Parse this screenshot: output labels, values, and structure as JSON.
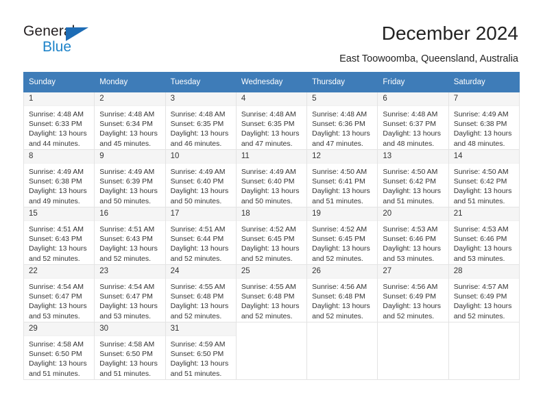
{
  "brand": {
    "name_top": "General",
    "name_bottom": "Blue",
    "logo_icon": "triangle-flag-icon",
    "accent_color": "#1d6cb5",
    "blue_text_color": "#1d83c9"
  },
  "header": {
    "title": "December 2024",
    "subtitle": "East Toowoomba, Queensland, Australia"
  },
  "calendar": {
    "header_bg": "#3e7cb8",
    "daynum_bg": "#f5f5f5",
    "weekdays": [
      "Sunday",
      "Monday",
      "Tuesday",
      "Wednesday",
      "Thursday",
      "Friday",
      "Saturday"
    ],
    "labels": {
      "sunrise": "Sunrise:",
      "sunset": "Sunset:",
      "daylight": "Daylight:"
    },
    "weeks": [
      [
        {
          "day": "1",
          "sunrise": "Sunrise: 4:48 AM",
          "sunset": "Sunset: 6:33 PM",
          "daylight1": "Daylight: 13 hours",
          "daylight2": "and 44 minutes."
        },
        {
          "day": "2",
          "sunrise": "Sunrise: 4:48 AM",
          "sunset": "Sunset: 6:34 PM",
          "daylight1": "Daylight: 13 hours",
          "daylight2": "and 45 minutes."
        },
        {
          "day": "3",
          "sunrise": "Sunrise: 4:48 AM",
          "sunset": "Sunset: 6:35 PM",
          "daylight1": "Daylight: 13 hours",
          "daylight2": "and 46 minutes."
        },
        {
          "day": "4",
          "sunrise": "Sunrise: 4:48 AM",
          "sunset": "Sunset: 6:35 PM",
          "daylight1": "Daylight: 13 hours",
          "daylight2": "and 47 minutes."
        },
        {
          "day": "5",
          "sunrise": "Sunrise: 4:48 AM",
          "sunset": "Sunset: 6:36 PM",
          "daylight1": "Daylight: 13 hours",
          "daylight2": "and 47 minutes."
        },
        {
          "day": "6",
          "sunrise": "Sunrise: 4:48 AM",
          "sunset": "Sunset: 6:37 PM",
          "daylight1": "Daylight: 13 hours",
          "daylight2": "and 48 minutes."
        },
        {
          "day": "7",
          "sunrise": "Sunrise: 4:49 AM",
          "sunset": "Sunset: 6:38 PM",
          "daylight1": "Daylight: 13 hours",
          "daylight2": "and 48 minutes."
        }
      ],
      [
        {
          "day": "8",
          "sunrise": "Sunrise: 4:49 AM",
          "sunset": "Sunset: 6:38 PM",
          "daylight1": "Daylight: 13 hours",
          "daylight2": "and 49 minutes."
        },
        {
          "day": "9",
          "sunrise": "Sunrise: 4:49 AM",
          "sunset": "Sunset: 6:39 PM",
          "daylight1": "Daylight: 13 hours",
          "daylight2": "and 50 minutes."
        },
        {
          "day": "10",
          "sunrise": "Sunrise: 4:49 AM",
          "sunset": "Sunset: 6:40 PM",
          "daylight1": "Daylight: 13 hours",
          "daylight2": "and 50 minutes."
        },
        {
          "day": "11",
          "sunrise": "Sunrise: 4:49 AM",
          "sunset": "Sunset: 6:40 PM",
          "daylight1": "Daylight: 13 hours",
          "daylight2": "and 50 minutes."
        },
        {
          "day": "12",
          "sunrise": "Sunrise: 4:50 AM",
          "sunset": "Sunset: 6:41 PM",
          "daylight1": "Daylight: 13 hours",
          "daylight2": "and 51 minutes."
        },
        {
          "day": "13",
          "sunrise": "Sunrise: 4:50 AM",
          "sunset": "Sunset: 6:42 PM",
          "daylight1": "Daylight: 13 hours",
          "daylight2": "and 51 minutes."
        },
        {
          "day": "14",
          "sunrise": "Sunrise: 4:50 AM",
          "sunset": "Sunset: 6:42 PM",
          "daylight1": "Daylight: 13 hours",
          "daylight2": "and 51 minutes."
        }
      ],
      [
        {
          "day": "15",
          "sunrise": "Sunrise: 4:51 AM",
          "sunset": "Sunset: 6:43 PM",
          "daylight1": "Daylight: 13 hours",
          "daylight2": "and 52 minutes."
        },
        {
          "day": "16",
          "sunrise": "Sunrise: 4:51 AM",
          "sunset": "Sunset: 6:43 PM",
          "daylight1": "Daylight: 13 hours",
          "daylight2": "and 52 minutes."
        },
        {
          "day": "17",
          "sunrise": "Sunrise: 4:51 AM",
          "sunset": "Sunset: 6:44 PM",
          "daylight1": "Daylight: 13 hours",
          "daylight2": "and 52 minutes."
        },
        {
          "day": "18",
          "sunrise": "Sunrise: 4:52 AM",
          "sunset": "Sunset: 6:45 PM",
          "daylight1": "Daylight: 13 hours",
          "daylight2": "and 52 minutes."
        },
        {
          "day": "19",
          "sunrise": "Sunrise: 4:52 AM",
          "sunset": "Sunset: 6:45 PM",
          "daylight1": "Daylight: 13 hours",
          "daylight2": "and 52 minutes."
        },
        {
          "day": "20",
          "sunrise": "Sunrise: 4:53 AM",
          "sunset": "Sunset: 6:46 PM",
          "daylight1": "Daylight: 13 hours",
          "daylight2": "and 53 minutes."
        },
        {
          "day": "21",
          "sunrise": "Sunrise: 4:53 AM",
          "sunset": "Sunset: 6:46 PM",
          "daylight1": "Daylight: 13 hours",
          "daylight2": "and 53 minutes."
        }
      ],
      [
        {
          "day": "22",
          "sunrise": "Sunrise: 4:54 AM",
          "sunset": "Sunset: 6:47 PM",
          "daylight1": "Daylight: 13 hours",
          "daylight2": "and 53 minutes."
        },
        {
          "day": "23",
          "sunrise": "Sunrise: 4:54 AM",
          "sunset": "Sunset: 6:47 PM",
          "daylight1": "Daylight: 13 hours",
          "daylight2": "and 53 minutes."
        },
        {
          "day": "24",
          "sunrise": "Sunrise: 4:55 AM",
          "sunset": "Sunset: 6:48 PM",
          "daylight1": "Daylight: 13 hours",
          "daylight2": "and 52 minutes."
        },
        {
          "day": "25",
          "sunrise": "Sunrise: 4:55 AM",
          "sunset": "Sunset: 6:48 PM",
          "daylight1": "Daylight: 13 hours",
          "daylight2": "and 52 minutes."
        },
        {
          "day": "26",
          "sunrise": "Sunrise: 4:56 AM",
          "sunset": "Sunset: 6:48 PM",
          "daylight1": "Daylight: 13 hours",
          "daylight2": "and 52 minutes."
        },
        {
          "day": "27",
          "sunrise": "Sunrise: 4:56 AM",
          "sunset": "Sunset: 6:49 PM",
          "daylight1": "Daylight: 13 hours",
          "daylight2": "and 52 minutes."
        },
        {
          "day": "28",
          "sunrise": "Sunrise: 4:57 AM",
          "sunset": "Sunset: 6:49 PM",
          "daylight1": "Daylight: 13 hours",
          "daylight2": "and 52 minutes."
        }
      ],
      [
        {
          "day": "29",
          "sunrise": "Sunrise: 4:58 AM",
          "sunset": "Sunset: 6:50 PM",
          "daylight1": "Daylight: 13 hours",
          "daylight2": "and 51 minutes."
        },
        {
          "day": "30",
          "sunrise": "Sunrise: 4:58 AM",
          "sunset": "Sunset: 6:50 PM",
          "daylight1": "Daylight: 13 hours",
          "daylight2": "and 51 minutes."
        },
        {
          "day": "31",
          "sunrise": "Sunrise: 4:59 AM",
          "sunset": "Sunset: 6:50 PM",
          "daylight1": "Daylight: 13 hours",
          "daylight2": "and 51 minutes."
        },
        {
          "day": "",
          "sunrise": "",
          "sunset": "",
          "daylight1": "",
          "daylight2": ""
        },
        {
          "day": "",
          "sunrise": "",
          "sunset": "",
          "daylight1": "",
          "daylight2": ""
        },
        {
          "day": "",
          "sunrise": "",
          "sunset": "",
          "daylight1": "",
          "daylight2": ""
        },
        {
          "day": "",
          "sunrise": "",
          "sunset": "",
          "daylight1": "",
          "daylight2": ""
        }
      ]
    ]
  }
}
